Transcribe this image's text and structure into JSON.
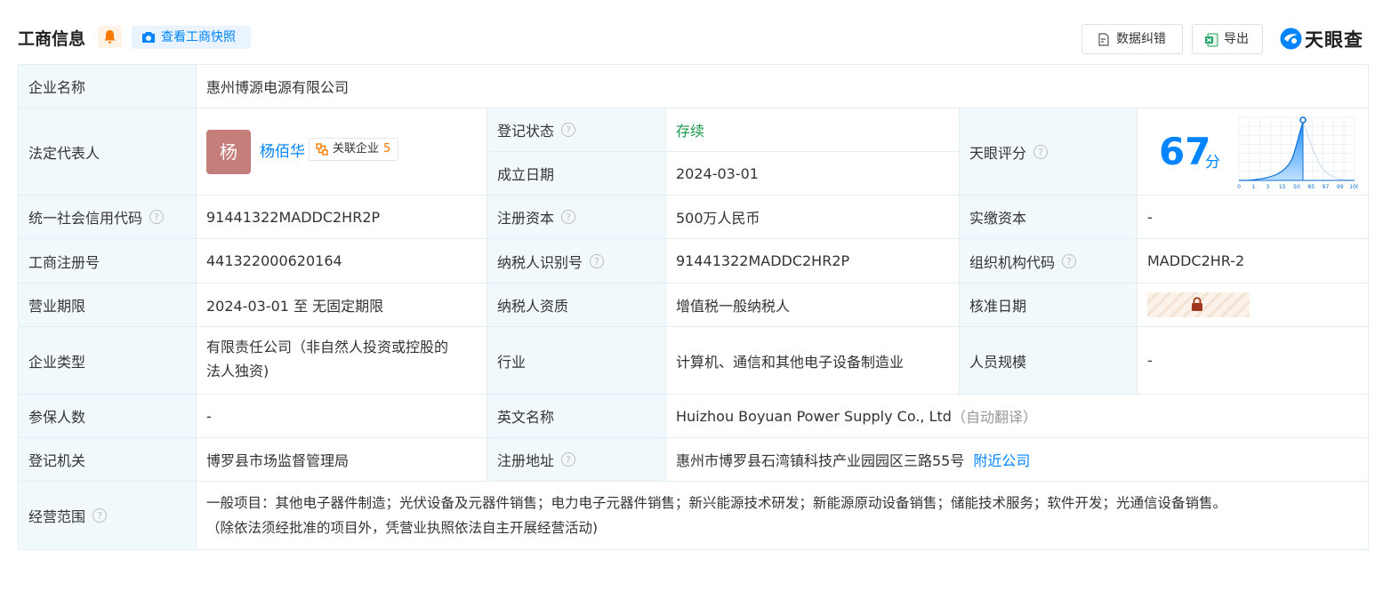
{
  "header": {
    "title": "工商信息",
    "snapshot_label": "查看工商快照",
    "correct_label": "数据纠错",
    "export_label": "导出",
    "logo_text": "天眼查"
  },
  "row1": {
    "label": "企业名称",
    "value": "惠州博源电源有限公司"
  },
  "legal": {
    "label": "法定代表人",
    "avatar": "杨",
    "name": "杨佰华",
    "related_label": "关联企业",
    "related_count": "5"
  },
  "status": {
    "label": "登记状态",
    "value": "存续"
  },
  "founded": {
    "label": "成立日期",
    "value": "2024-03-01"
  },
  "score": {
    "label": "天眼评分",
    "value": "67",
    "unit": "分",
    "ticks": [
      "0",
      "1",
      "3",
      "15",
      "50",
      "85",
      "97",
      "99",
      "100"
    ]
  },
  "credit_code": {
    "label": "统一社会信用代码",
    "value": "91441322MADDC2HR2P"
  },
  "reg_capital": {
    "label": "注册资本",
    "value": "500万人民币"
  },
  "paid_capital": {
    "label": "实缴资本",
    "value": "-"
  },
  "reg_no": {
    "label": "工商注册号",
    "value": "441322000620164"
  },
  "taxpayer_id": {
    "label": "纳税人识别号",
    "value": "91441322MADDC2HR2P"
  },
  "org_code": {
    "label": "组织机构代码",
    "value": "MADDC2HR-2"
  },
  "term": {
    "label": "营业期限",
    "value": "2024-03-01 至 无固定期限"
  },
  "tax_qual": {
    "label": "纳税人资质",
    "value": "增值税一般纳税人"
  },
  "approve_date": {
    "label": "核准日期"
  },
  "company_type": {
    "label": "企业类型",
    "value_line1": "有限责任公司（非自然人投资或控股的",
    "value_line2": "法人独资)"
  },
  "industry": {
    "label": "行业",
    "value": "计算机、通信和其他电子设备制造业"
  },
  "staff_size": {
    "label": "人员规模",
    "value": "-"
  },
  "insured": {
    "label": "参保人数",
    "value": "-"
  },
  "english_name": {
    "label": "英文名称",
    "value": "Huizhou Boyuan Power Supply Co., Ltd",
    "note": "（自动翻译）"
  },
  "authority": {
    "label": "登记机关",
    "value": "博罗县市场监督管理局"
  },
  "address": {
    "label": "注册地址",
    "value": "惠州市博罗县石湾镇科技产业园园区三路55号",
    "link": "附近公司"
  },
  "scope": {
    "label": "经营范围",
    "line1": "一般项目：其他电子器件制造；光伏设备及元器件销售；电力电子元器件销售；新兴能源技术研发；新能源原动设备销售；储能技术服务；软件开发；光通信设备销售。",
    "line2": "（除依法须经批准的项目外，凭营业执照依法自主开展经营活动)"
  },
  "colors": {
    "accent": "#0084ff",
    "label_bg": "#f2f9fc",
    "status_green": "#1a9a4a",
    "avatar_bg": "#c57e7b",
    "count_orange": "#ff7a00"
  }
}
